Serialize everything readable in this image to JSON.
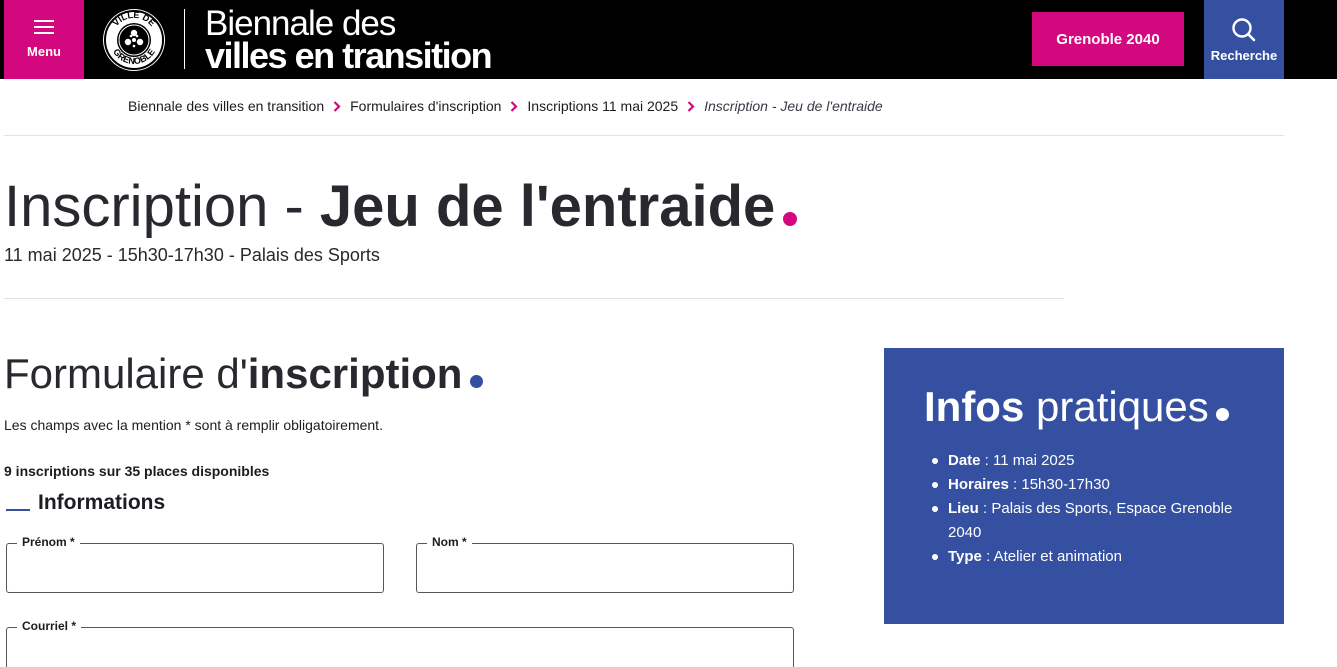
{
  "header": {
    "menu_label": "Menu",
    "seal_text": "VILLE DE GRENOBLE",
    "site_title_line1": "Biennale des",
    "site_title_line2": "villes en transition",
    "cta_label": "Grenoble 2040",
    "search_label": "Recherche",
    "colors": {
      "header_bg": "#000000",
      "accent_pink": "#d3087f",
      "accent_blue": "#3550a0"
    },
    "icons": [
      "hamburger-icon",
      "search-icon",
      "city-seal-logo"
    ]
  },
  "breadcrumb": [
    {
      "label": "Biennale des villes en transition"
    },
    {
      "label": "Formulaires d'inscription"
    },
    {
      "label": "Inscriptions 11 mai 2025"
    },
    {
      "label": "Inscription - Jeu de l'entraide"
    }
  ],
  "page": {
    "title_light": "Inscription - ",
    "title_bold": "Jeu de l'entraide",
    "subtitle": "11 mai 2025 - 15h30-17h30 - Palais des Sports"
  },
  "form": {
    "title_light": "Formulaire d'",
    "title_bold": "inscription",
    "mandatory_note": "Les champs avec la mention * sont à remplir obligatoirement.",
    "places": "9 inscriptions sur 35 places disponibles",
    "section_title": "Informations",
    "fields": {
      "prenom": {
        "label": "Prénom *",
        "value": ""
      },
      "nom": {
        "label": "Nom *",
        "value": ""
      },
      "courriel": {
        "label": "Courriel *",
        "value": ""
      }
    }
  },
  "infos": {
    "title_bold": "Infos",
    "title_light": " pratiques",
    "items": [
      {
        "key": "Date",
        "value": " : 11 mai 2025"
      },
      {
        "key": "Horaires",
        "value": " : 15h30-17h30"
      },
      {
        "key": "Lieu",
        "value": " : Palais des Sports, Espace Grenoble 2040"
      },
      {
        "key": "Type",
        "value": " : Atelier et animation"
      }
    ]
  }
}
